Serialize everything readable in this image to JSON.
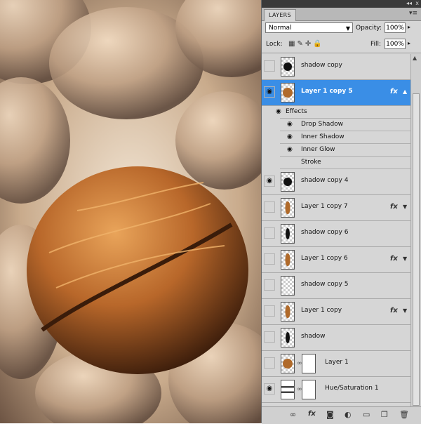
{
  "panel": {
    "tab_label": "LAYERS",
    "menu_icon": "panel-menu-icon",
    "collapse_icon": "double-chevron-icon",
    "blend_mode": "Normal",
    "opacity_label": "Opacity:",
    "opacity_value": "100%",
    "lock_label": "Lock:",
    "fill_label": "Fill:",
    "fill_value": "100%"
  },
  "layers": [
    {
      "name": "shadow copy",
      "visible": false,
      "thumb": "dot",
      "selected": false,
      "fx": false
    },
    {
      "name": "Layer 1 copy 5",
      "visible": true,
      "thumb": "nut",
      "selected": true,
      "fx": true
    },
    {
      "name": "shadow copy 4",
      "visible": true,
      "thumb": "dot",
      "selected": false,
      "fx": false
    },
    {
      "name": "Layer 1 copy 7",
      "visible": false,
      "thumb": "nut-slim",
      "selected": false,
      "fx": true
    },
    {
      "name": "shadow copy 6",
      "visible": false,
      "thumb": "dot-slim",
      "selected": false,
      "fx": false
    },
    {
      "name": "Layer 1 copy 6",
      "visible": false,
      "thumb": "nut-slim",
      "selected": false,
      "fx": true
    },
    {
      "name": "shadow copy 5",
      "visible": false,
      "thumb": "empty",
      "selected": false,
      "fx": false
    },
    {
      "name": "Layer 1 copy",
      "visible": false,
      "thumb": "nut-slim",
      "selected": false,
      "fx": true
    },
    {
      "name": "shadow",
      "visible": false,
      "thumb": "dot-slim",
      "selected": false,
      "fx": false
    },
    {
      "name": "Layer 1",
      "visible": false,
      "thumb": "nut",
      "selected": false,
      "fx": false,
      "mask": true
    },
    {
      "name": "Hue/Saturation 1",
      "visible": true,
      "thumb": "adjust",
      "selected": false,
      "fx": false,
      "mask": true
    }
  ],
  "effects": {
    "label": "Effects",
    "items": [
      {
        "name": "Drop Shadow",
        "visible": true
      },
      {
        "name": "Inner Shadow",
        "visible": true
      },
      {
        "name": "Inner Glow",
        "visible": true
      },
      {
        "name": "Stroke",
        "visible": false
      }
    ]
  },
  "footer_icons": [
    "link-icon",
    "fx-icon",
    "mask-icon",
    "adjustment-icon",
    "group-folder-icon",
    "new-layer-icon",
    "trash-icon"
  ],
  "colors": {
    "selection": "#3a8ee6",
    "panel": "#d6d6d6",
    "nut": "#b06a2a"
  }
}
